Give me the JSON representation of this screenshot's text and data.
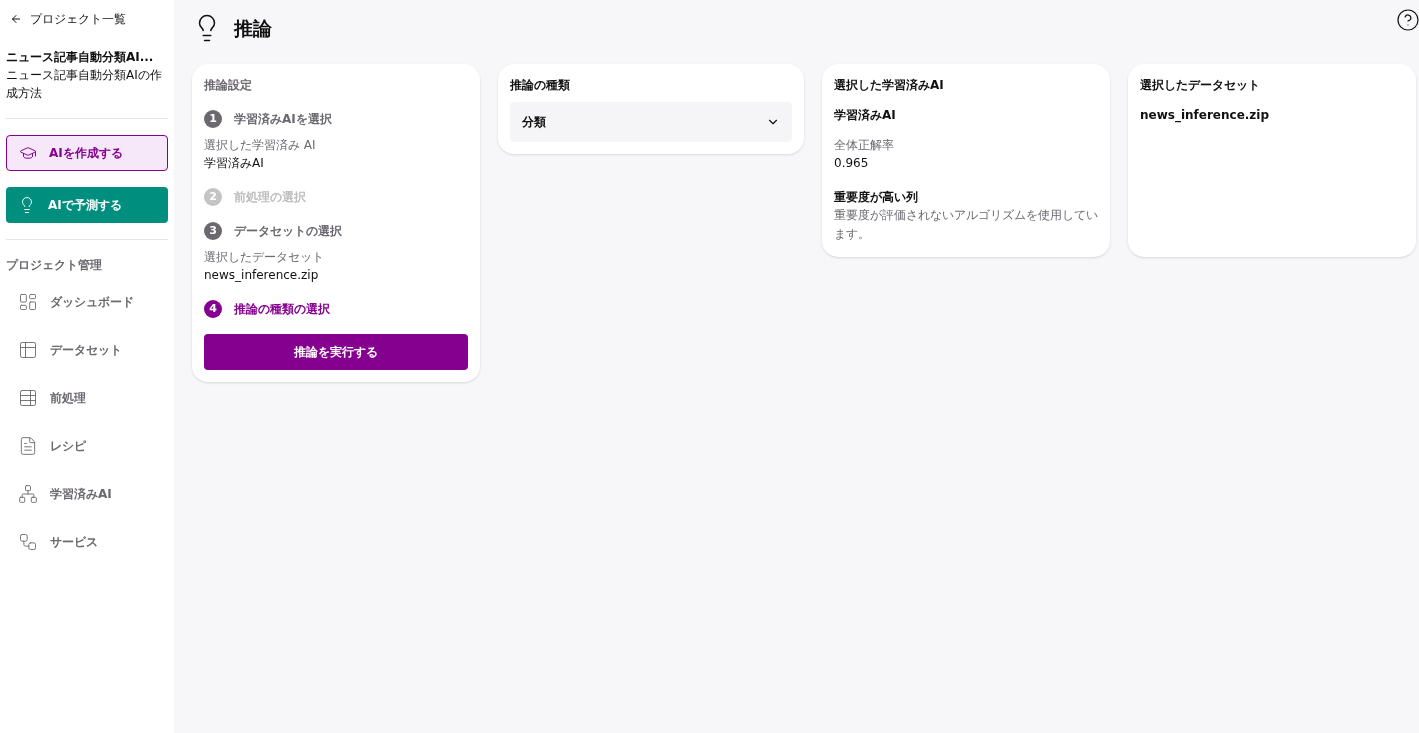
{
  "sidebar": {
    "back_link": "プロジェクト一覧",
    "project_title": "ニュース記事自動分類AI...",
    "project_subtitle": "ニュース記事自動分類AIの作成方法",
    "actions": [
      {
        "label": "AIを作成する",
        "kind": "outline"
      },
      {
        "label": "AIで予測する",
        "kind": "filled"
      }
    ],
    "section_title": "プロジェクト管理",
    "items": [
      {
        "label": "ダッシュボード"
      },
      {
        "label": "データセット"
      },
      {
        "label": "前処理"
      },
      {
        "label": "レシピ"
      },
      {
        "label": "学習済みAI"
      },
      {
        "label": "サービス"
      }
    ]
  },
  "header": {
    "title": "推論"
  },
  "settings": {
    "title": "推論設定",
    "steps": [
      {
        "number": "1",
        "label": "学習済みAIを選択",
        "kind": "done",
        "detail_label": "選択した学習済み AI",
        "detail_value": "学習済みAI"
      },
      {
        "number": "2",
        "label": "前処理の選択",
        "kind": "disabled"
      },
      {
        "number": "3",
        "label": "データセットの選択",
        "kind": "done",
        "detail_label": "選択したデータセット",
        "detail_value": "news_inference.zip"
      },
      {
        "number": "4",
        "label": "推論の種類の選択",
        "kind": "current"
      }
    ],
    "run_button": "推論を実行する"
  },
  "inference_type": {
    "title": "推論の種類",
    "value": "分類"
  },
  "selected_model": {
    "title": "選択した学習済みAI",
    "name": "学習済みAI",
    "accuracy_label": "全体正解率",
    "accuracy_value": "0.965",
    "importance_title": "重要度が高い列",
    "importance_text": "重要度が評価されないアルゴリズムを使用しています。"
  },
  "selected_dataset": {
    "title": "選択したデータセット",
    "name": "news_inference.zip"
  }
}
